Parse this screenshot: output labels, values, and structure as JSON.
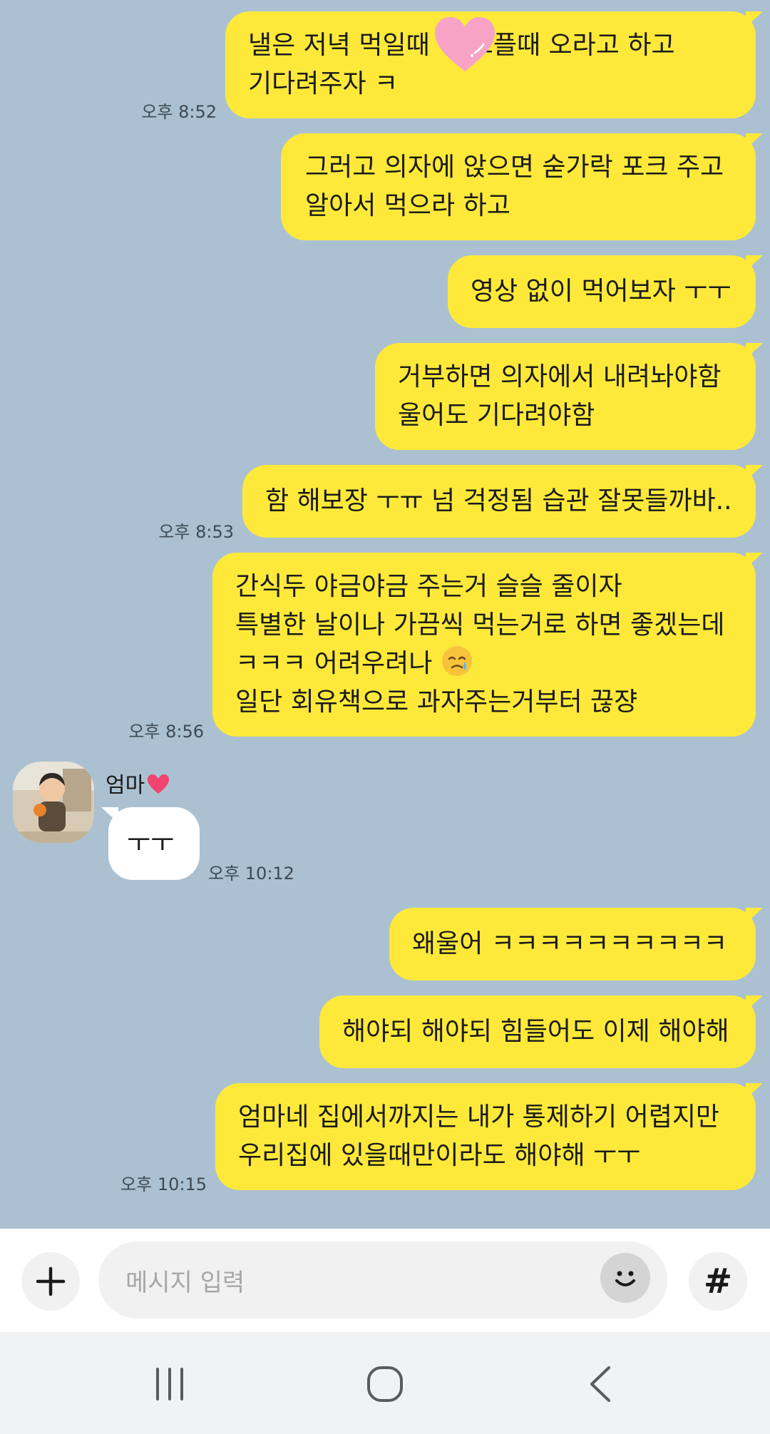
{
  "colors": {
    "chat_background": "#abc1d1",
    "outgoing_bubble": "#fee93a",
    "incoming_bubble": "#ffffff"
  },
  "messages": [
    {
      "text": "낼은 저녁 먹일때  배고플때 오라고 하고\n기다려주자 ㅋ",
      "time": "오후 8:52"
    },
    {
      "text": "그러고 의자에 앉으면 숟가락 포크 주고\n알아서 먹으라 하고"
    },
    {
      "text": "영상 없이 먹어보자 ㅜㅜ"
    },
    {
      "text": "거부하면 의자에서 내려놔야함\n울어도 기다려야함"
    },
    {
      "text": "함 해보장 ㅜㅠ 넘 걱정됨 습관 잘못들까바..",
      "time": "오후 8:53"
    },
    {
      "line1": "간식두 야금야금 주는거 슬슬 줄이자",
      "line2": "특별한 날이나 가끔씩 먹는거로 하면 좋겠는데",
      "line3": "ㅋㅋㅋ 어려우려나",
      "line4": "일단 회유책으로 과자주는거부터 끊쟝",
      "time": "오후 8:56"
    },
    {
      "sender": "엄마",
      "text": "ㅜㅜ",
      "time": "오후 10:12"
    },
    {
      "text": "왜울어 ㅋㅋㅋㅋㅋㅋㅋㅋㅋㅋ"
    },
    {
      "text": "해야되 해야되 힘들어도 이제 해야해"
    },
    {
      "text": "엄마네 집에서까지는 내가 통제하기 어렵지만\n우리집에 있을때만이라도 해야해 ㅜㅜ",
      "time": "오후 10:15"
    }
  ],
  "input": {
    "placeholder": "메시지 입력",
    "hash_label": "#"
  },
  "icons": {
    "heart_sticker": "heart-sticker-icon",
    "crying_emoji": "face-holding-back-tears-icon",
    "sender_heart": "heart-icon"
  }
}
